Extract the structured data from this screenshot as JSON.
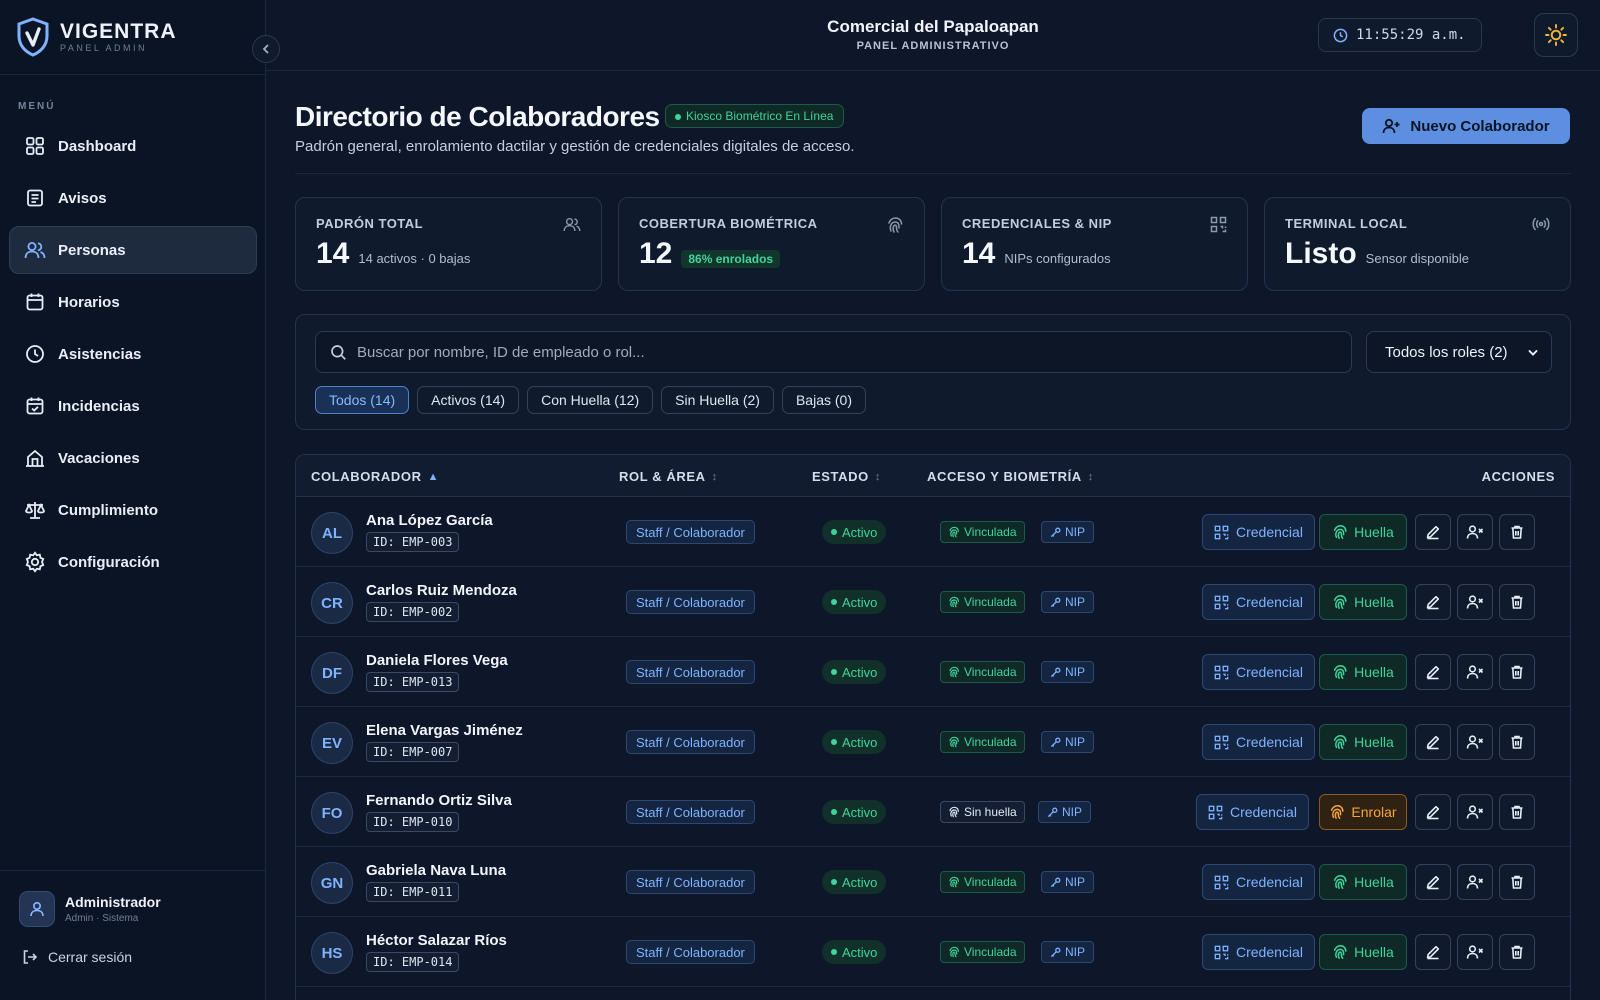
{
  "brand": {
    "name": "VIGENTRA",
    "sub": "PANEL ADMIN"
  },
  "header": {
    "company": "Comercial del Papaloapan",
    "subtitle": "PANEL ADMINISTRATIVO",
    "clock": "11:55:29 a.m."
  },
  "sidebar": {
    "menu_label": "MENÚ",
    "items": [
      {
        "label": "Dashboard",
        "icon": "dashboard-icon"
      },
      {
        "label": "Avisos",
        "icon": "notice-icon"
      },
      {
        "label": "Personas",
        "icon": "users-icon",
        "active": true
      },
      {
        "label": "Horarios",
        "icon": "calendar-icon"
      },
      {
        "label": "Asistencias",
        "icon": "clock-icon"
      },
      {
        "label": "Incidencias",
        "icon": "calendar-check-icon"
      },
      {
        "label": "Vacaciones",
        "icon": "beach-icon"
      },
      {
        "label": "Cumplimiento",
        "icon": "scale-icon"
      },
      {
        "label": "Configuración",
        "icon": "gear-icon"
      }
    ],
    "user": {
      "name": "Administrador",
      "role": "Admin · Sistema"
    },
    "logout": "Cerrar sesión"
  },
  "page": {
    "title": "Directorio de Colaboradores",
    "kiosk_status": "Kiosco Biométrico En Línea",
    "subtitle": "Padrón general, enrolamiento dactilar y gestión de credenciales digitales de acceso.",
    "new_button": "Nuevo Colaborador"
  },
  "stats": [
    {
      "label": "PADRÓN TOTAL",
      "value": "14",
      "note": "14 activos · 0 bajas",
      "icon": "users-icon"
    },
    {
      "label": "COBERTURA BIOMÉTRICA",
      "value": "12",
      "badge": "86% enrolados",
      "icon": "fingerprint-icon"
    },
    {
      "label": "CREDENCIALES & NIP",
      "value": "14",
      "note": "NIPs configurados",
      "icon": "qr-icon"
    },
    {
      "label": "TERMINAL LOCAL",
      "value": "Listo",
      "note": "Sensor disponible",
      "icon": "signal-icon"
    }
  ],
  "filters": {
    "search_placeholder": "Buscar por nombre, ID de empleado o rol...",
    "role_select": "Todos los roles (2)",
    "chips": [
      "Todos (14)",
      "Activos (14)",
      "Con Huella (12)",
      "Sin Huella (2)",
      "Bajas (0)"
    ]
  },
  "table": {
    "headers": {
      "colaborador": "COLABORADOR",
      "rol": "ROL & ÁREA",
      "estado": "ESTADO",
      "acceso": "ACCESO Y BIOMETRÍA",
      "acciones": "ACCIONES"
    },
    "sort_marks": {
      "asc": "▲",
      "both": "↕"
    },
    "labels": {
      "credencial": "Credencial",
      "nip": "NIP"
    },
    "rows": [
      {
        "initials": "AL",
        "name": "Ana López García",
        "id": "ID: EMP-003",
        "role": "Staff / Colaborador",
        "status": "Activo",
        "bio": "Vinculada",
        "action": "Huella",
        "enrolled": true
      },
      {
        "initials": "CR",
        "name": "Carlos Ruiz Mendoza",
        "id": "ID: EMP-002",
        "role": "Staff / Colaborador",
        "status": "Activo",
        "bio": "Vinculada",
        "action": "Huella",
        "enrolled": true
      },
      {
        "initials": "DF",
        "name": "Daniela Flores Vega",
        "id": "ID: EMP-013",
        "role": "Staff / Colaborador",
        "status": "Activo",
        "bio": "Vinculada",
        "action": "Huella",
        "enrolled": true
      },
      {
        "initials": "EV",
        "name": "Elena Vargas Jiménez",
        "id": "ID: EMP-007",
        "role": "Staff / Colaborador",
        "status": "Activo",
        "bio": "Vinculada",
        "action": "Huella",
        "enrolled": true
      },
      {
        "initials": "FO",
        "name": "Fernando Ortiz Silva",
        "id": "ID: EMP-010",
        "role": "Staff / Colaborador",
        "status": "Activo",
        "bio": "Sin huella",
        "action": "Enrolar",
        "enrolled": false
      },
      {
        "initials": "GN",
        "name": "Gabriela Nava Luna",
        "id": "ID: EMP-011",
        "role": "Staff / Colaborador",
        "status": "Activo",
        "bio": "Vinculada",
        "action": "Huella",
        "enrolled": true
      },
      {
        "initials": "HS",
        "name": "Héctor Salazar Ríos",
        "id": "ID: EMP-014",
        "role": "Staff / Colaborador",
        "status": "Activo",
        "bio": "Vinculada",
        "action": "Huella",
        "enrolled": true
      }
    ]
  },
  "colors": {
    "background": "#0d1729",
    "accent": "#5d8fe0",
    "success": "#3fd49a",
    "warning": "#f5a53d"
  }
}
